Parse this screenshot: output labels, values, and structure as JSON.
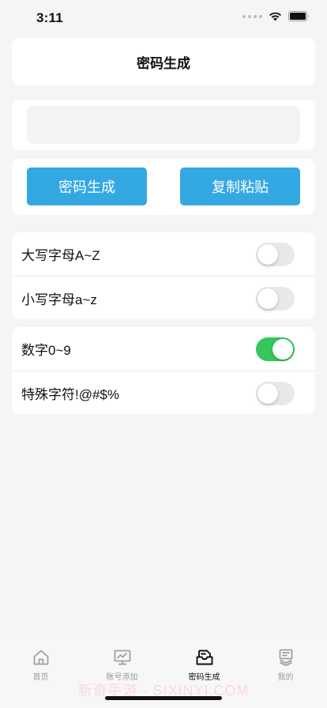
{
  "status_bar": {
    "time": "3:11"
  },
  "header": {
    "title": "密码生成"
  },
  "output": {
    "value": "",
    "placeholder": ""
  },
  "actions": {
    "generate_label": "密码生成",
    "copy_label": "复制粘贴"
  },
  "options": [
    {
      "label": "大写字母A~Z",
      "enabled": false
    },
    {
      "label": "小写字母a~z",
      "enabled": false
    },
    {
      "label": "数字0~9",
      "enabled": true
    },
    {
      "label": "特殊字符!@#$%",
      "enabled": false
    }
  ],
  "tabbar": {
    "tabs": [
      {
        "label": "首页",
        "icon": "home-icon",
        "active": false
      },
      {
        "label": "账号添加",
        "icon": "monitor-chart-icon",
        "active": false
      },
      {
        "label": "密码生成",
        "icon": "inbox-icon",
        "active": true
      },
      {
        "label": "我的",
        "icon": "document-stack-icon",
        "active": false
      }
    ]
  },
  "watermark": "新奇手游 · SIXINYI.COM",
  "colors": {
    "accent": "#33a8e3",
    "toggle_on": "#34c759",
    "toggle_off": "#e9e9eb",
    "background": "#f5f5f7"
  }
}
